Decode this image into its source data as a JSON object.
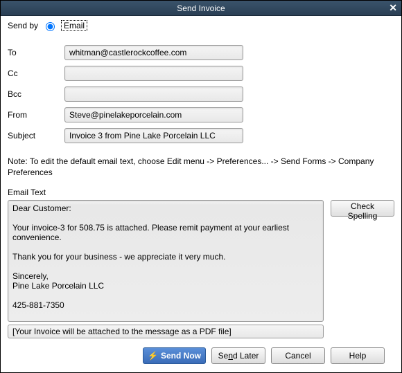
{
  "title": "Send Invoice",
  "sendby": {
    "label": "Send by",
    "option": "Email"
  },
  "fields": {
    "to": {
      "label": "To",
      "value": "whitman@castlerockcoffee.com"
    },
    "cc": {
      "label": "Cc",
      "value": ""
    },
    "bcc": {
      "label": "Bcc",
      "value": ""
    },
    "from": {
      "label": "From",
      "value": "Steve@pinelakeporcelain.com"
    },
    "subject": {
      "label": "Subject",
      "value": "Invoice 3 from Pine Lake Porcelain LLC"
    }
  },
  "note": "Note: To edit the default email text, choose Edit menu -> Preferences... -> Send Forms -> Company Preferences",
  "emailTextLabel": "Email Text",
  "emailBody": "Dear Customer:\n\nYour invoice-3 for 508.75 is attached. Please remit payment at your earliest convenience.\n\nThank you for your business - we appreciate it very much.\n\nSincerely,\nPine Lake Porcelain LLC\n\n425-881-7350",
  "checkSpelling": "Check Spelling",
  "attachNote": "[Your Invoice will be attached to the message as a PDF file]",
  "buttons": {
    "sendNow": "Send Now",
    "sendLater": "Send Later",
    "cancel": "Cancel",
    "help": "Help"
  }
}
